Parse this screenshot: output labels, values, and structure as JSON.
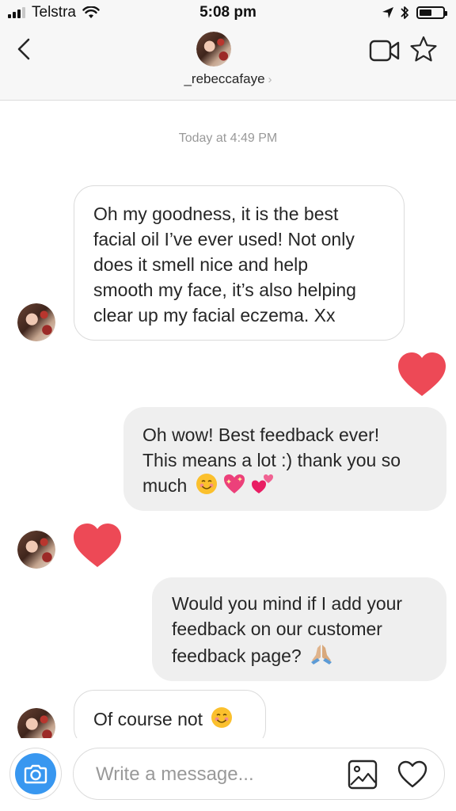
{
  "status_bar": {
    "carrier": "Telstra",
    "time": "5:08 pm",
    "signal_bars": 3,
    "battery_level": 0.55
  },
  "header": {
    "username": "_rebeccafaye",
    "chevron": "›",
    "back_icon": "chevron-left-icon",
    "video_icon": "video-camera-icon",
    "star_icon": "star-outline-icon"
  },
  "conversation": {
    "timestamp": "Today at 4:49 PM",
    "messages": [
      {
        "sender": "them",
        "lines": [
          "Oh my goodness, it is the best",
          "facial oil I’ve ever used! Not only",
          "does it smell nice and help",
          "smooth my face, it’s also helping",
          "clear up my facial eczema. Xx"
        ]
      },
      {
        "sender": "me",
        "type": "heart",
        "color": "#ed4956"
      },
      {
        "sender": "me",
        "lines": [
          "Oh wow! Best feedback ever!",
          "This means a lot :) thank you so",
          "much"
        ],
        "emojis": [
          "smiling-face-emoji",
          "sparkling-heart-emoji",
          "two-hearts-emoji"
        ]
      },
      {
        "sender": "them",
        "type": "heart",
        "color": "#ed4956"
      },
      {
        "sender": "me",
        "lines": [
          "Would you mind if I add your",
          "feedback on our customer",
          "feedback page?"
        ],
        "emojis": [
          "folded-hands-emoji"
        ]
      },
      {
        "sender": "them",
        "lines": [
          "Of course not"
        ],
        "emojis": [
          "smiling-face-emoji"
        ]
      }
    ]
  },
  "composer": {
    "placeholder": "Write a message...",
    "camera_icon": "camera-icon",
    "gallery_icon": "image-gallery-icon",
    "like_icon": "heart-outline-icon"
  },
  "colors": {
    "accent": "#3897f0",
    "heart": "#ed4956",
    "bubble_out": "#efefef",
    "border": "#dbdbdb"
  }
}
